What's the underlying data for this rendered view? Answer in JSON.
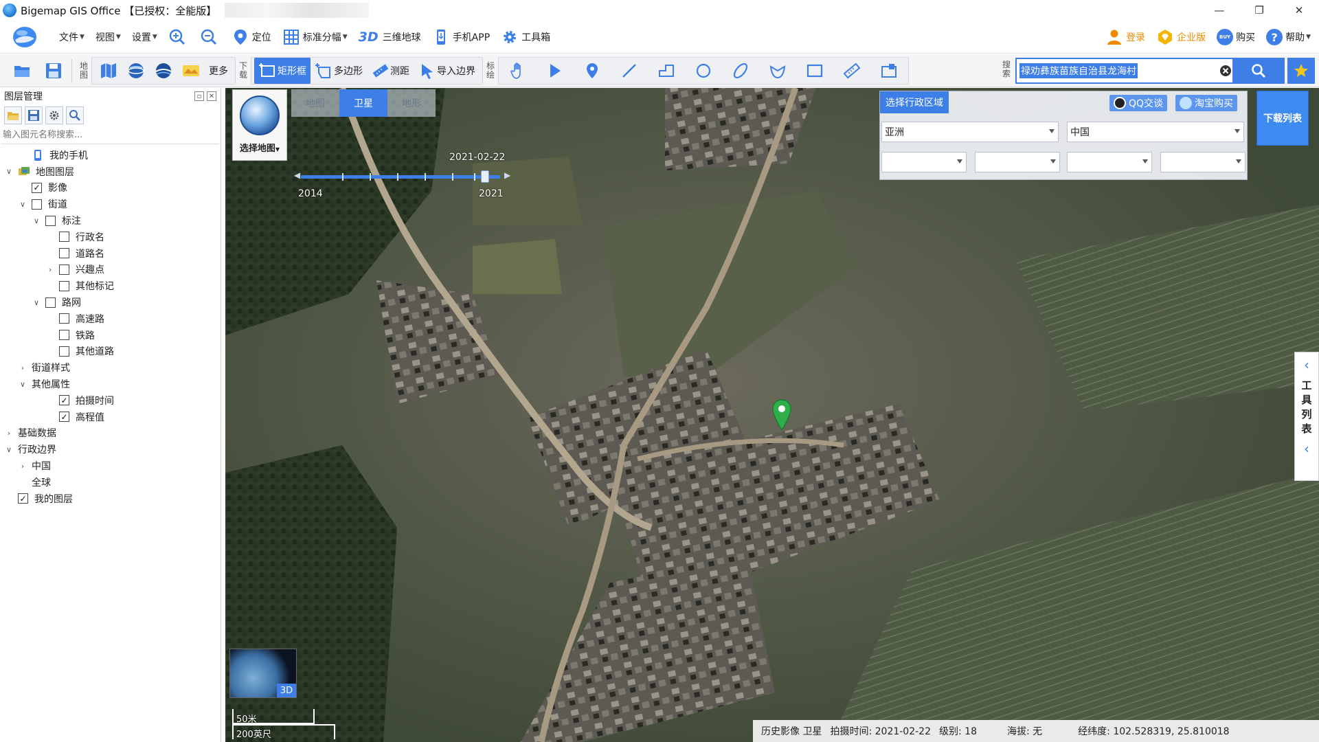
{
  "window": {
    "title": "Bigemap GIS Office 【已授权：全能版】",
    "minimize": "—",
    "restore": "❐",
    "close": "✕"
  },
  "menu": {
    "file": "文件",
    "view": "视图",
    "settings": "设置",
    "locate": "定位",
    "standard_sheets": "标准分幅",
    "globe_3d_badge": "3D",
    "globe_3d": "三维地球",
    "mobile_app": "手机APP",
    "toolbox": "工具箱",
    "login": "登录",
    "enterprise": "企业版",
    "buy": "购买",
    "help": "帮助",
    "buy_badge": "BUY"
  },
  "toolbar": {
    "map_label": "地图",
    "more": "更多",
    "download_label": "下载",
    "rect_frame": "矩形框",
    "polygon": "多边形",
    "measure": "测距",
    "import_boundary": "导入边界",
    "draw_label": "标绘",
    "search_label": "搜索",
    "search_value": "禄劝彝族苗族自治县龙海村"
  },
  "layer_panel": {
    "title": "图层管理",
    "search_placeholder": "输入图元名称搜索...",
    "tree": [
      {
        "label": "我的手机",
        "level": 1,
        "toggle": "",
        "checkbox": null,
        "icon": "phone-icon"
      },
      {
        "label": "地图图层",
        "level": 0,
        "toggle": "∨",
        "checkbox": null,
        "icon": "layers-icon"
      },
      {
        "label": "影像",
        "level": 1,
        "toggle": "",
        "checkbox": true,
        "icon": null
      },
      {
        "label": "街道",
        "level": 1,
        "toggle": "∨",
        "checkbox": false,
        "icon": null
      },
      {
        "label": "标注",
        "level": 2,
        "toggle": "∨",
        "checkbox": false,
        "icon": null
      },
      {
        "label": "行政名",
        "level": 3,
        "toggle": "",
        "checkbox": false,
        "icon": null
      },
      {
        "label": "道路名",
        "level": 3,
        "toggle": "",
        "checkbox": false,
        "icon": null
      },
      {
        "label": "兴趣点",
        "level": 3,
        "toggle": "›",
        "checkbox": false,
        "icon": null
      },
      {
        "label": "其他标记",
        "level": 3,
        "toggle": "",
        "checkbox": false,
        "icon": null
      },
      {
        "label": "路网",
        "level": 2,
        "toggle": "∨",
        "checkbox": false,
        "icon": null
      },
      {
        "label": "高速路",
        "level": 3,
        "toggle": "",
        "checkbox": false,
        "icon": null
      },
      {
        "label": "铁路",
        "level": 3,
        "toggle": "",
        "checkbox": false,
        "icon": null
      },
      {
        "label": "其他道路",
        "level": 3,
        "toggle": "",
        "checkbox": false,
        "icon": null
      },
      {
        "label": "街道样式",
        "level": 1,
        "toggle": "›",
        "checkbox": null,
        "icon": null
      },
      {
        "label": "其他属性",
        "level": 1,
        "toggle": "∨",
        "checkbox": null,
        "icon": null
      },
      {
        "label": "拍摄时间",
        "level": 3,
        "toggle": "",
        "checkbox": true,
        "icon": null
      },
      {
        "label": "高程值",
        "level": 3,
        "toggle": "",
        "checkbox": true,
        "icon": null
      },
      {
        "label": "基础数据",
        "level": 0,
        "toggle": "›",
        "checkbox": null,
        "icon": null
      },
      {
        "label": "行政边界",
        "level": 0,
        "toggle": "∨",
        "checkbox": null,
        "icon": null
      },
      {
        "label": "中国",
        "level": 1,
        "toggle": "›",
        "checkbox": null,
        "icon": null
      },
      {
        "label": "全球",
        "level": 1,
        "toggle": "",
        "checkbox": null,
        "icon": null
      },
      {
        "label": "我的图层",
        "level": 0,
        "toggle": "",
        "checkbox": true,
        "icon": null
      }
    ]
  },
  "map": {
    "select_map": "选择地图",
    "tabs": [
      "地图",
      "卫星",
      "地形"
    ],
    "active_tab": "卫星",
    "timeline": {
      "date": "2021-02-22",
      "start_year": "2014",
      "end_year": "2021",
      "position": 1.0
    },
    "admin": {
      "title": "选择行政区域",
      "qq": "QQ交谈",
      "taobao": "淘宝购买",
      "continent": "亚洲",
      "country": "中国",
      "sub1": "",
      "sub2": "",
      "sub3": "",
      "sub4": ""
    },
    "download_list": "下载列表",
    "tool_list": "工具列表",
    "minimap_3d": "3D",
    "scale_metric": "50米",
    "scale_imperial": "200英尺",
    "status": {
      "source": "历史影像 卫星",
      "shot_time_label": "拍摄时间:",
      "shot_time": "2021-02-22",
      "level_label": "级别:",
      "level": "18",
      "altitude_label": "海拔:",
      "altitude": "无",
      "coords_label": "经纬度:",
      "coords": "102.528319, 25.810018"
    }
  },
  "colors": {
    "accent": "#3d7fe6",
    "marker": "#2fae4a",
    "orange": "#f08a00"
  }
}
